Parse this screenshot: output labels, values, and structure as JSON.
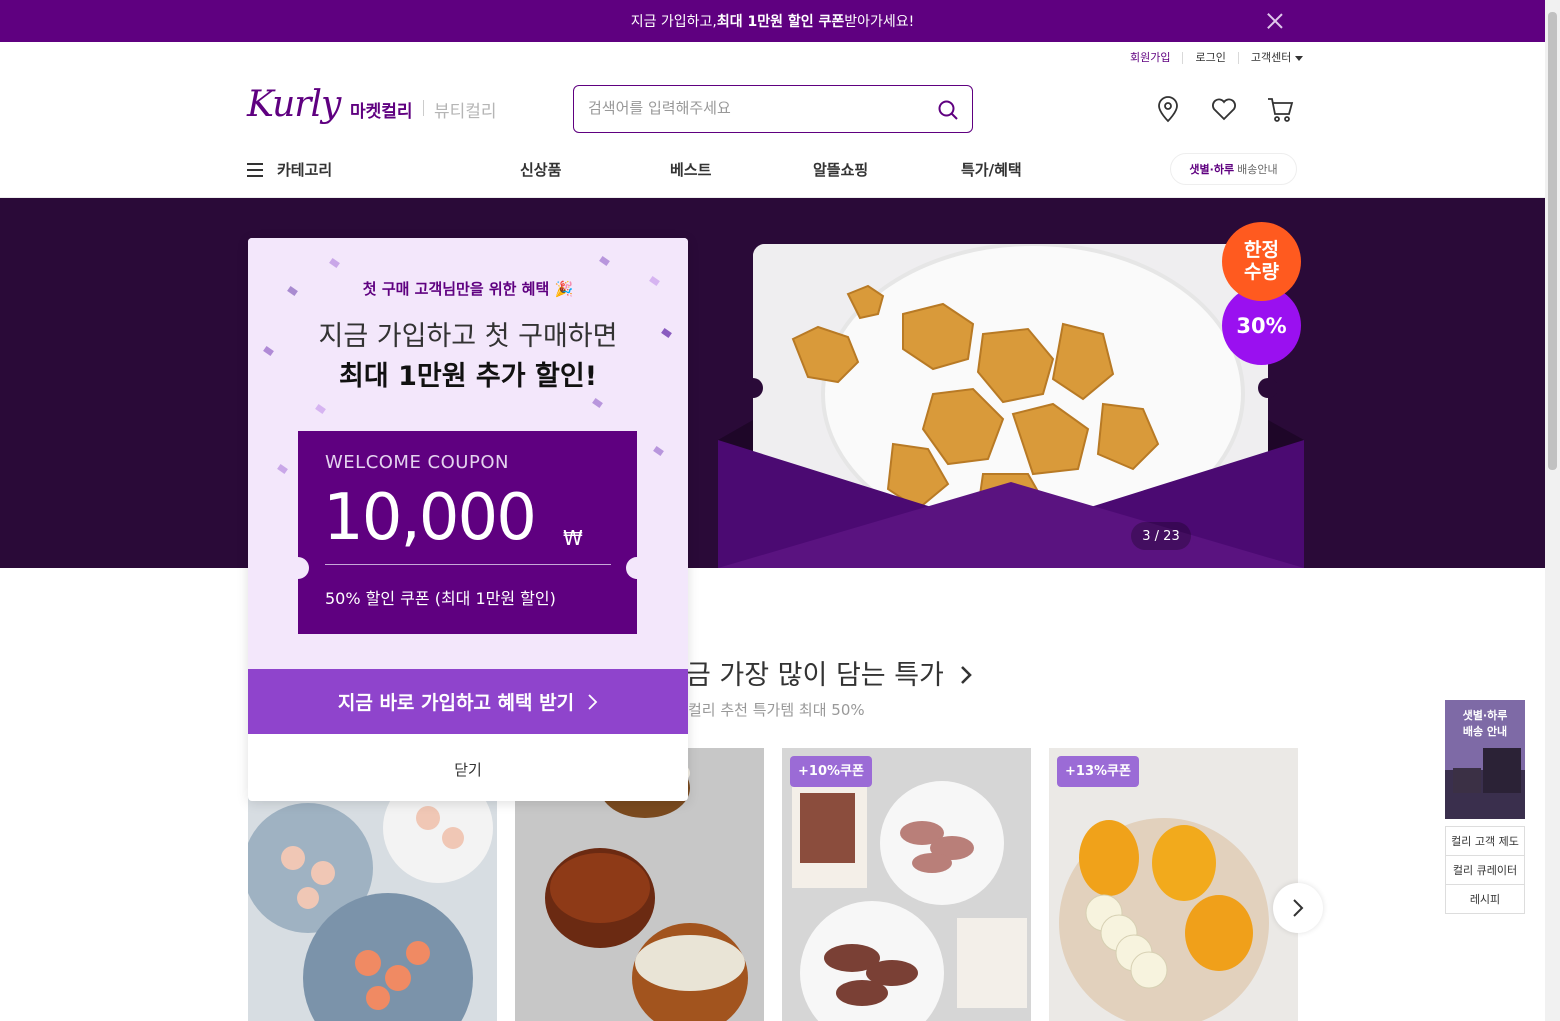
{
  "top_banner": {
    "text_pre": "지금 가입하고, ",
    "text_bold": "최대 1만원 할인 쿠폰",
    "text_post": " 받아가세요!"
  },
  "user_menu": {
    "signup": "회원가입",
    "login": "로그인",
    "customer_center": "고객센터"
  },
  "header": {
    "logo_text": "Kurly",
    "tab_market": "마켓컬리",
    "tab_beauty": "뷰티컬리",
    "search_placeholder": "검색어를 입력해주세요"
  },
  "nav": {
    "category": "카테고리",
    "items": [
      "신상품",
      "베스트",
      "알뜰쇼핑",
      "특가/혜택"
    ],
    "delivery_bold": "샛별·하루",
    "delivery_text": "배송안내"
  },
  "hero": {
    "counter": "3 / 23",
    "badge_limited_line1": "한정",
    "badge_limited_line2": "수량",
    "badge_percent": "30%"
  },
  "section": {
    "title": "금 가장 많이 담는 특가",
    "subtitle": "컬리 추천 특가템 최대 50%"
  },
  "products": [
    {
      "coupon": ""
    },
    {
      "coupon": ""
    },
    {
      "coupon": "+10%쿠폰"
    },
    {
      "coupon": "+13%쿠폰"
    }
  ],
  "side_menu": {
    "banner_line1": "샛별·하루",
    "banner_line2": "배송 안내",
    "links": [
      "컬리 고객 제도",
      "컬리 큐레이터",
      "레시피"
    ]
  },
  "popup": {
    "kicker": "첫 구매 고객님만을 위한 혜택 🎉",
    "line1": "지금 가입하고 첫 구매하면",
    "line2": "최대 1만원 추가 할인!",
    "coupon_label": "WELCOME COUPON",
    "coupon_amount": "10,000",
    "coupon_currency": "₩",
    "coupon_desc": "50% 할인 쿠폰 (최대 1만원 할인)",
    "cta": "지금 바로 가입하고 혜택 받기",
    "close": "닫기"
  },
  "colors": {
    "brand": "#5f0080",
    "cta": "#8f44cc",
    "hero_bg": "#2a0a38",
    "badge_orange": "#ff5a1f",
    "badge_purple": "#9a10f0"
  }
}
